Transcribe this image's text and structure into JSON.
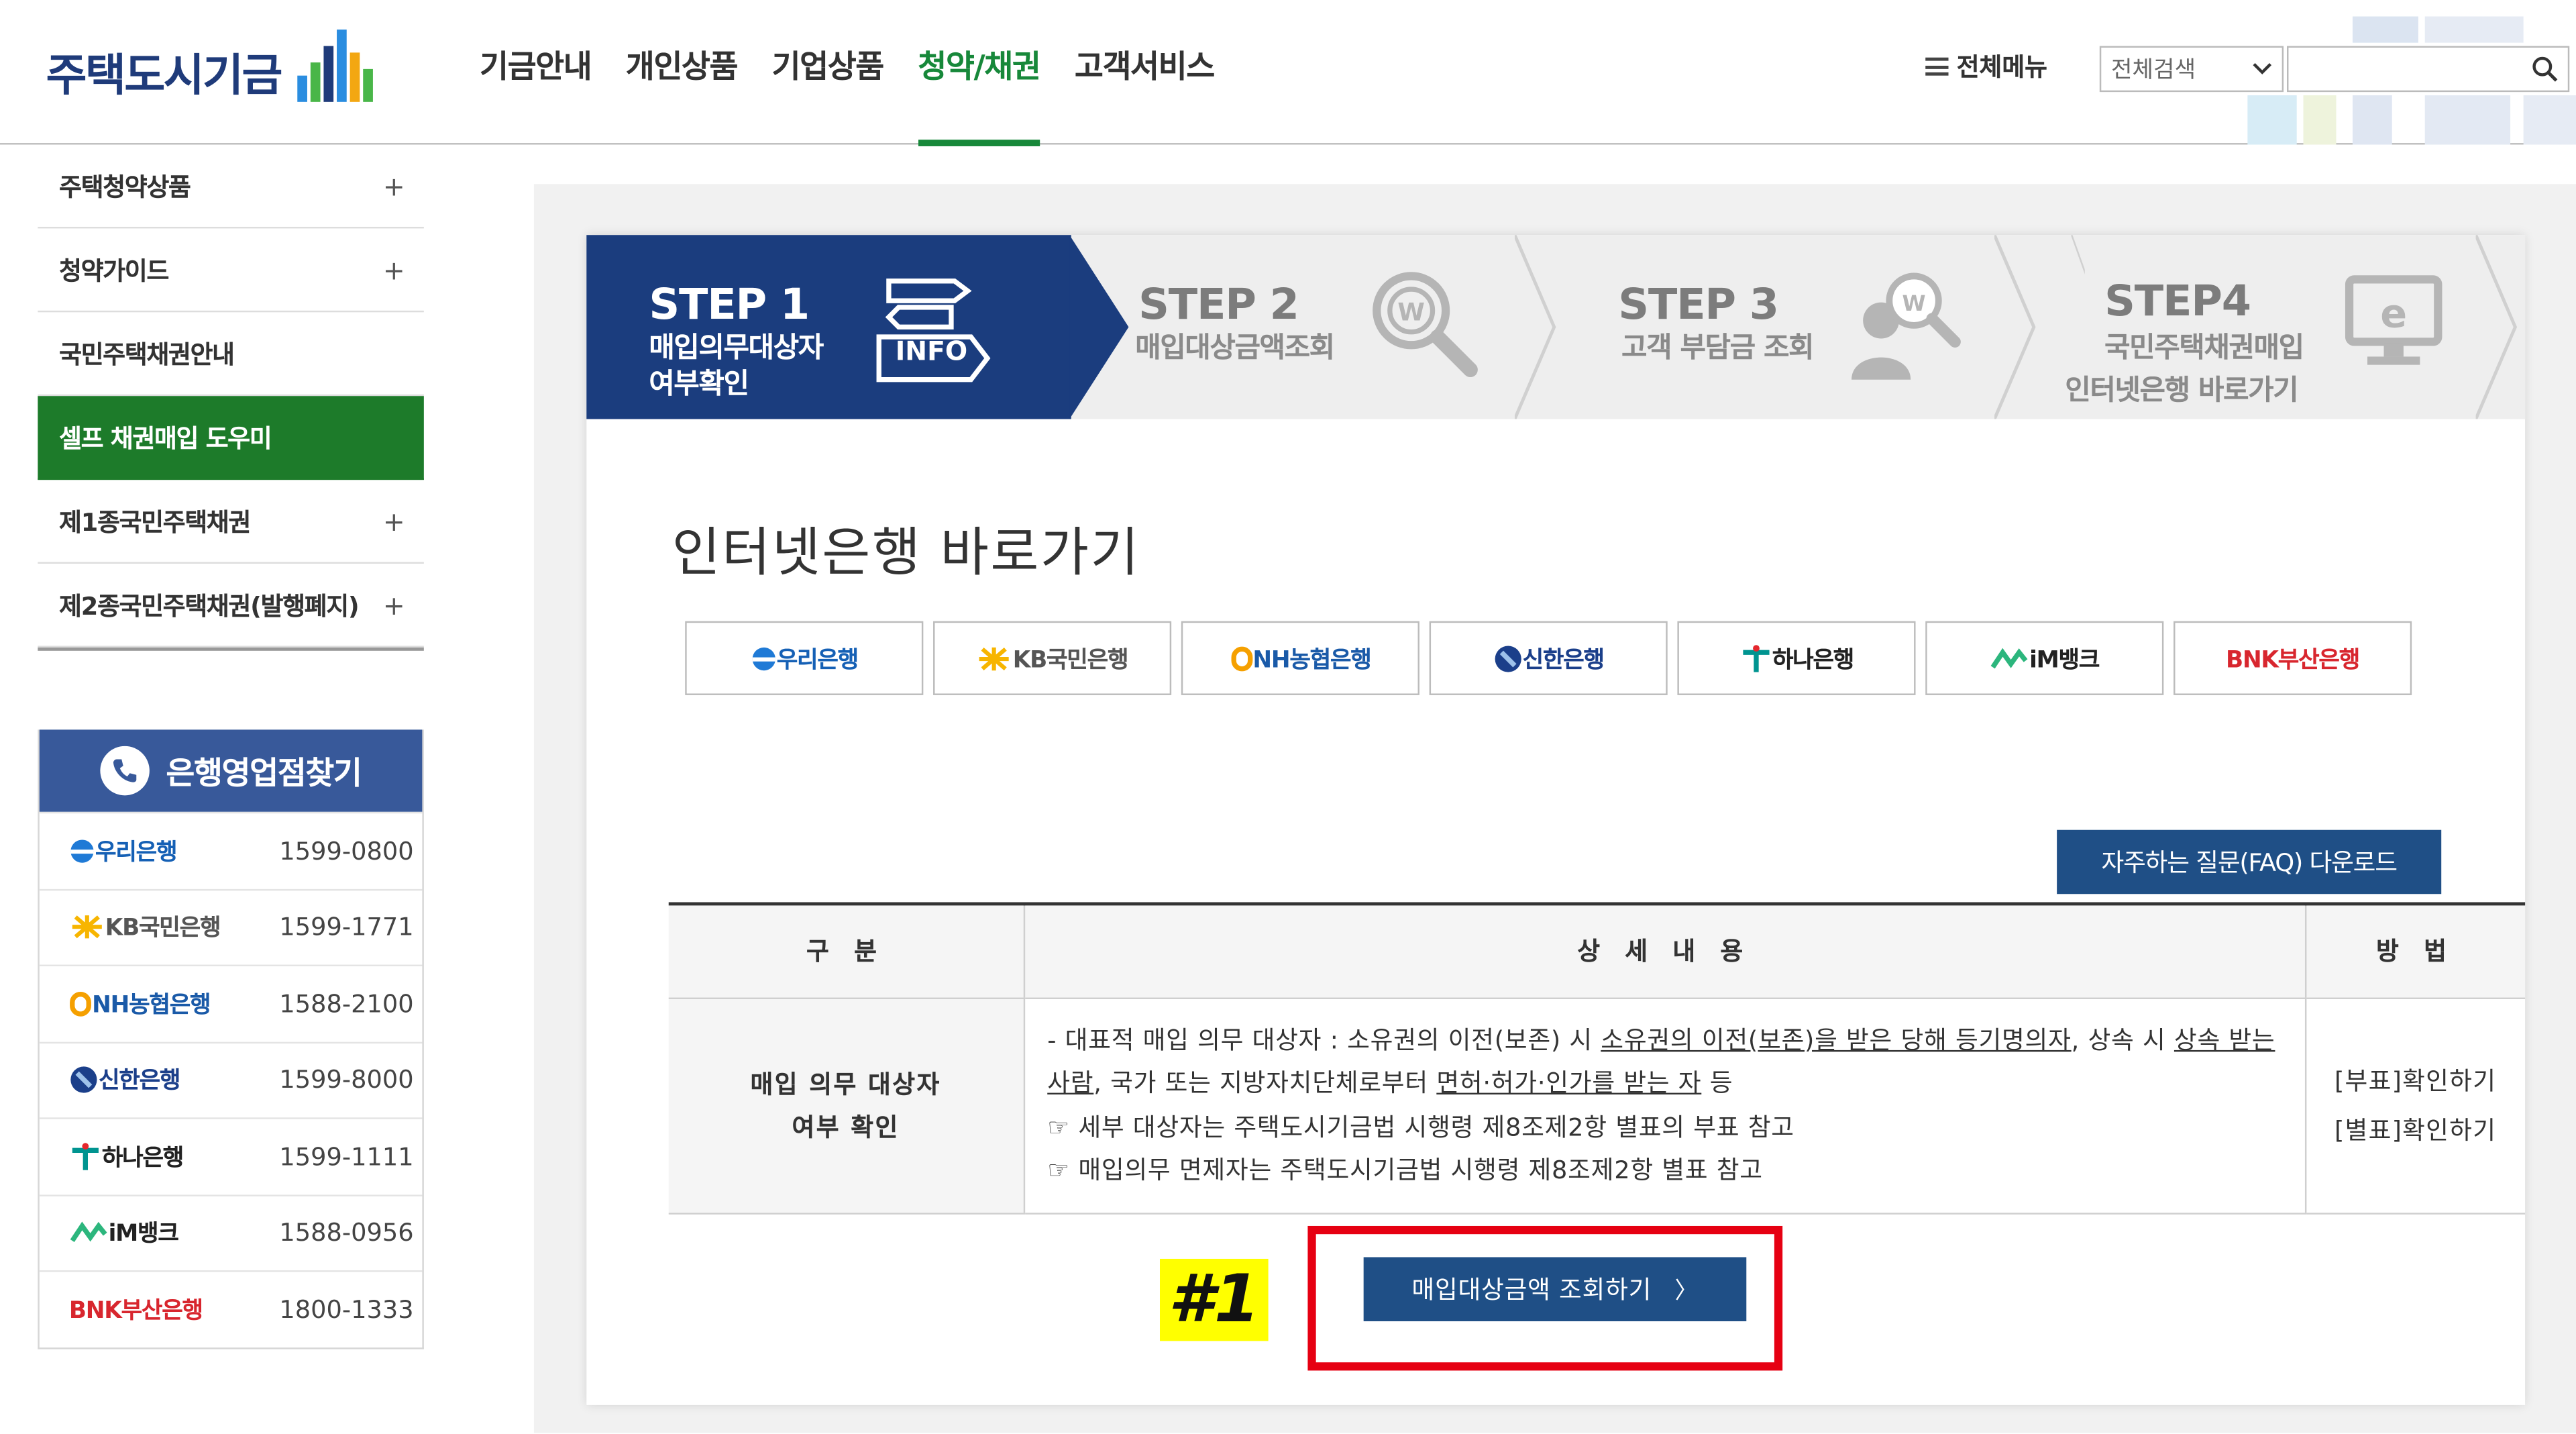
{
  "header": {
    "logo_text": "주택도시기금",
    "nav": [
      "기금안내",
      "개인상품",
      "기업상품",
      "청약/채권",
      "고객서비스"
    ],
    "nav_active_index": 3,
    "all_menu": "전체메뉴",
    "search_select": "전체검색",
    "search_value": ""
  },
  "sidebar": {
    "items": [
      {
        "label": "주택청약상품",
        "plus": "+"
      },
      {
        "label": "청약가이드",
        "plus": "+"
      },
      {
        "label": "국민주택채권안내",
        "plus": ""
      },
      {
        "label": "셀프 채권매입 도우미",
        "plus": ""
      },
      {
        "label": "제1종국민주택채권",
        "plus": "+"
      },
      {
        "label": "제2종국민주택채권(발행폐지)",
        "plus": "+"
      }
    ],
    "active_index": 3
  },
  "branch_finder": {
    "title": "은행영업점찾기",
    "rows": [
      {
        "bank": "우리은행",
        "tel": "1599-0800"
      },
      {
        "bank": "KB국민은행",
        "tel": "1599-1771"
      },
      {
        "bank": "NH농협은행",
        "tel": "1588-2100"
      },
      {
        "bank": "신한은행",
        "tel": "1599-8000"
      },
      {
        "bank": "하나은행",
        "tel": "1599-1111"
      },
      {
        "bank": "iM뱅크",
        "tel": "1588-0956"
      },
      {
        "bank": "BNK부산은행",
        "tel": "1800-1333"
      }
    ]
  },
  "steps": [
    {
      "title": "STEP 1",
      "sub1": "매입의무대상자",
      "sub2": "여부확인",
      "badge": "INFO"
    },
    {
      "title": "STEP 2",
      "sub1": "매입대상금액조회",
      "sub2": ""
    },
    {
      "title": "STEP 3",
      "sub1": "고객 부담금 조회",
      "sub2": ""
    },
    {
      "title": "STEP4",
      "sub1": "국민주택채권매입",
      "sub2": "인터넷은행 바로가기"
    }
  ],
  "page_heading": "인터넷은행 바로가기",
  "bank_buttons": [
    "우리은행",
    "KB국민은행",
    "NH농협은행",
    "신한은행",
    "하나은행",
    "iM뱅크",
    "BNK부산은행"
  ],
  "faq_button": "자주하는 질문(FAQ) 다운로드",
  "table": {
    "headers": [
      "구 분",
      "상 세 내 용",
      "방 법"
    ],
    "row": {
      "gubun_line1": "매입 의무 대상자",
      "gubun_line2": "여부 확인",
      "detail": {
        "p1_a": "- 대표적 매입 의무 대상자 : 소유권의 이전(보존) 시 ",
        "p1_u1": "소유권의 이전(보존)을 받은 당해 등기명의자",
        "p1_b": ", 상속 시 ",
        "p1_u2": "상속 받는 사람",
        "p1_c": ", 국가 또는 지방자치단체로부터 ",
        "p1_u3": "면허·허가·인가를 받는 자",
        "p1_d": " 등",
        "p2": "☞ 세부 대상자는 주택도시기금법 시행령 제8조제2항 별표의 부표 참고",
        "p3": "☞ 매입의무 면제자는 주택도시기금법 시행령 제8조제2항 별표 참고"
      },
      "method1": "[부표]확인하기",
      "method2": "[별표]확인하기"
    }
  },
  "query_button": "매입대상금액 조회하기",
  "query_button_arrow": "〉",
  "annotation_marker": "#1",
  "colors": {
    "brand_green": "#17883a",
    "sidebar_active": "#1d7b2a",
    "navy": "#1b3d7e",
    "button_blue": "#1f4f86",
    "highlight_red": "#e60012",
    "marker_yellow": "#ffff00"
  }
}
